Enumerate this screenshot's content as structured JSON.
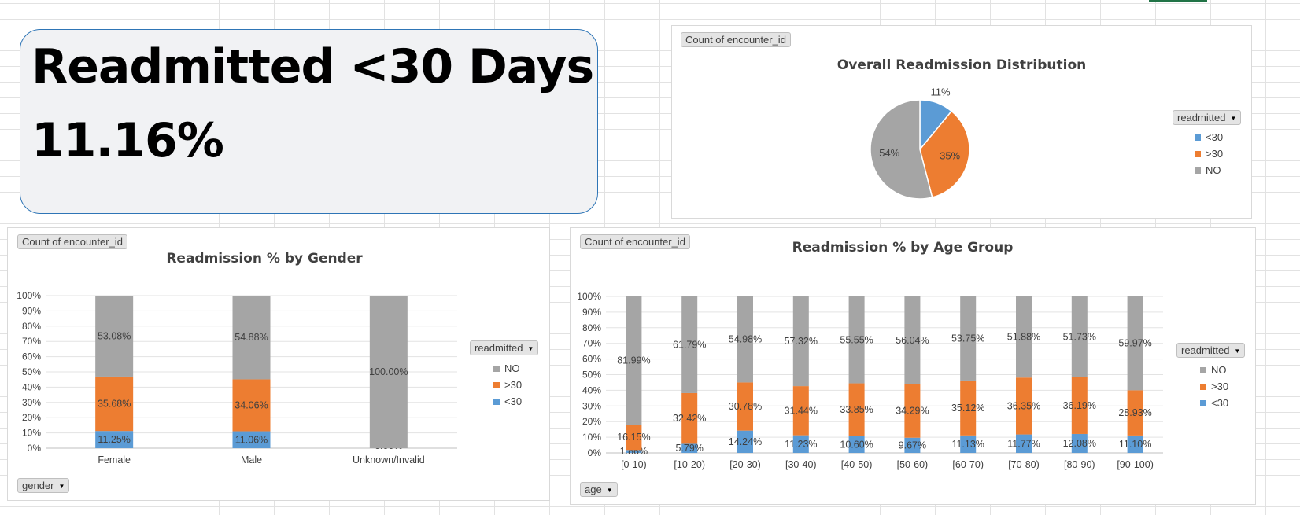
{
  "kpi": {
    "title": "Readmitted <30 Days",
    "value": "11.16%"
  },
  "colors": {
    "lt30": "#5b9bd5",
    "gt30": "#ed7d31",
    "no": "#a5a5a5"
  },
  "pie": {
    "value_pill": "Count of encounter_id",
    "legend_pill": "readmitted",
    "legend": [
      "<30",
      ">30",
      "NO"
    ]
  },
  "gender": {
    "value_pill": "Count of encounter_id",
    "legend_pill": "readmitted",
    "axis_pill": "gender",
    "legend": [
      "NO",
      ">30",
      "<30"
    ]
  },
  "age": {
    "value_pill": "Count of encounter_id",
    "legend_pill": "readmitted",
    "axis_pill": "age",
    "legend": [
      "NO",
      ">30",
      "<30"
    ]
  },
  "chart_data": [
    {
      "type": "pie",
      "title": "Overall Readmission Distribution",
      "categories": [
        "<30",
        ">30",
        "NO"
      ],
      "values": [
        11,
        35,
        54
      ],
      "labels": [
        "11%",
        "35%",
        "54%"
      ],
      "legend": "right"
    },
    {
      "type": "bar",
      "stacked": true,
      "title": "Readmission % by Gender",
      "categories": [
        "Female",
        "Male",
        "Unknown/Invalid"
      ],
      "y_ticks": [
        "0%",
        "10%",
        "20%",
        "30%",
        "40%",
        "50%",
        "60%",
        "70%",
        "80%",
        "90%",
        "100%"
      ],
      "ylim": [
        0,
        100
      ],
      "series": [
        {
          "name": "<30",
          "values": [
            11.25,
            11.06,
            0
          ],
          "labels": [
            "11.25%",
            "11.06%",
            "0.00%"
          ]
        },
        {
          "name": ">30",
          "values": [
            35.68,
            34.06,
            0
          ],
          "labels": [
            "35.68%",
            "34.06%",
            ""
          ]
        },
        {
          "name": "NO",
          "values": [
            53.08,
            54.88,
            100
          ],
          "labels": [
            "53.08%",
            "54.88%",
            "100.00%"
          ]
        }
      ],
      "grid": true,
      "legend": "right"
    },
    {
      "type": "bar",
      "stacked": true,
      "title": "Readmission % by Age Group",
      "categories": [
        "[0-10)",
        "[10-20)",
        "[20-30)",
        "[30-40)",
        "[40-50)",
        "[50-60)",
        "[60-70)",
        "[70-80)",
        "[80-90)",
        "[90-100)"
      ],
      "y_ticks": [
        "0%",
        "10%",
        "20%",
        "30%",
        "40%",
        "50%",
        "60%",
        "70%",
        "80%",
        "90%",
        "100%"
      ],
      "ylim": [
        0,
        100
      ],
      "series": [
        {
          "name": "<30",
          "values": [
            1.86,
            5.79,
            14.24,
            11.23,
            10.6,
            9.67,
            11.13,
            11.77,
            12.08,
            11.1
          ],
          "labels": [
            "1.86%",
            "5.79%",
            "14.24%",
            "11.23%",
            "10.60%",
            "9.67%",
            "11.13%",
            "11.77%",
            "12.08%",
            "11.10%"
          ]
        },
        {
          "name": ">30",
          "values": [
            16.15,
            32.42,
            30.78,
            31.44,
            33.85,
            34.29,
            35.12,
            36.35,
            36.19,
            28.93
          ],
          "labels": [
            "16.15%",
            "32.42%",
            "30.78%",
            "31.44%",
            "33.85%",
            "34.29%",
            "35.12%",
            "36.35%",
            "36.19%",
            "28.93%"
          ]
        },
        {
          "name": "NO",
          "values": [
            81.99,
            61.79,
            54.98,
            57.32,
            55.55,
            56.04,
            53.75,
            51.88,
            51.73,
            59.97
          ],
          "labels": [
            "81.99%",
            "61.79%",
            "54.98%",
            "57.32%",
            "55.55%",
            "56.04%",
            "53.75%",
            "51.88%",
            "51.73%",
            "59.97%"
          ]
        }
      ],
      "grid": true,
      "legend": "right"
    }
  ]
}
